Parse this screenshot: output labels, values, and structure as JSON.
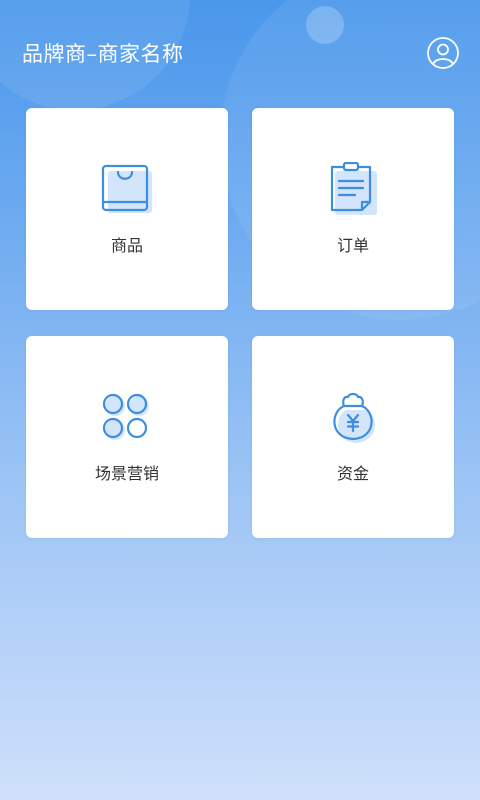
{
  "header": {
    "title": "品牌商–商家名称",
    "profile_icon": "user-profile-icon"
  },
  "menu": [
    {
      "label": "商品",
      "icon": "shopping-bag-icon"
    },
    {
      "label": "订单",
      "icon": "order-clipboard-icon"
    },
    {
      "label": "场景营销",
      "icon": "grid-circles-icon"
    },
    {
      "label": "资金",
      "icon": "money-bag-icon"
    }
  ],
  "colors": {
    "accent": "#3d8ee0",
    "icon_fill": "#cfe3fa",
    "background_top": "#4a97eb",
    "background_bottom": "#cfe0fb"
  }
}
